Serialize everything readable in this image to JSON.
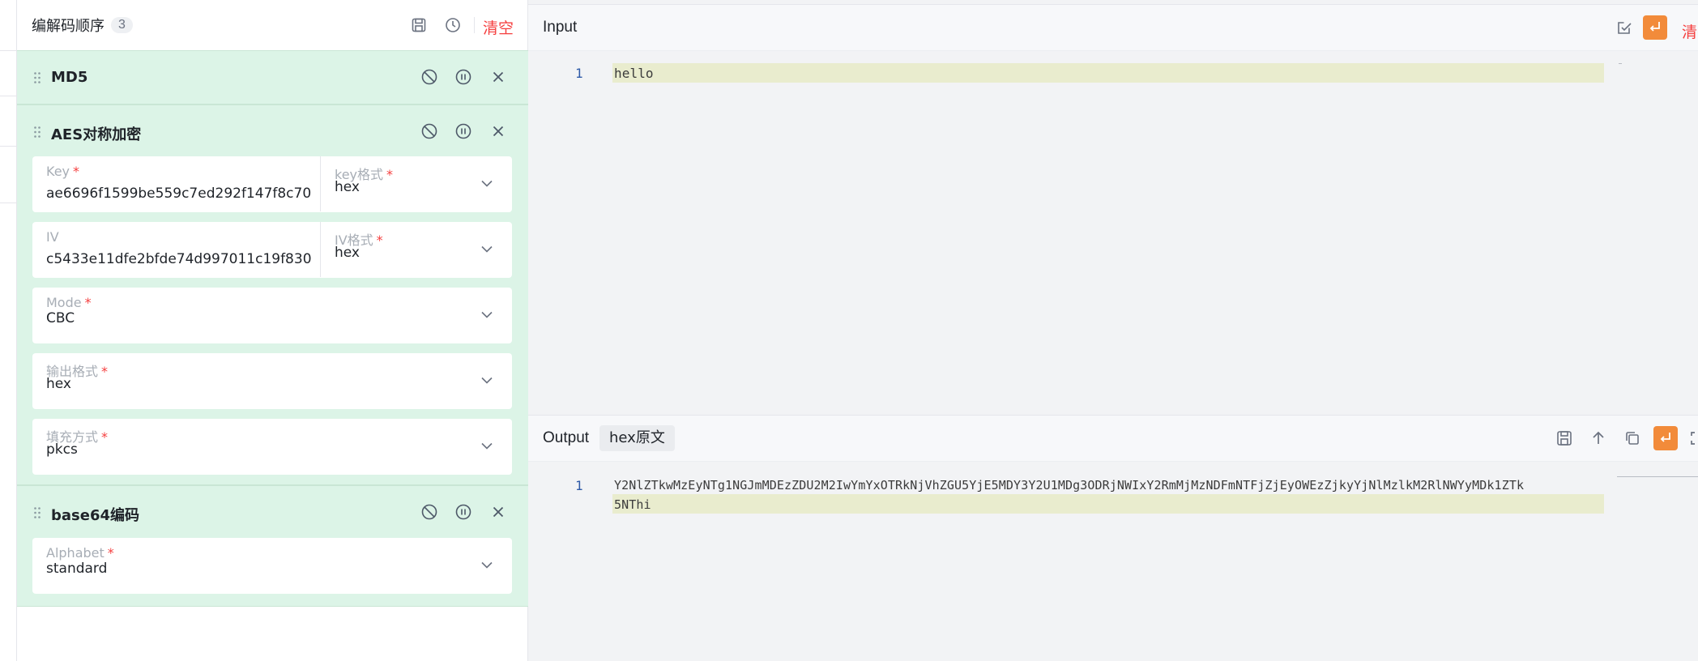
{
  "chain": {
    "title": "编解码顺序",
    "count": "3",
    "clear_label": "清空",
    "operations": [
      {
        "name": "MD5"
      },
      {
        "name": "AES对称加密",
        "fields": {
          "key_label": "Key",
          "key_value": "ae6696f1599be559c7ed292f147f8c70",
          "key_format_label": "key格式",
          "key_format_value": "hex",
          "iv_label": "IV",
          "iv_value": "c5433e11dfe2bfde74d997011c19f830",
          "iv_format_label": "IV格式",
          "iv_format_value": "hex",
          "mode_label": "Mode",
          "mode_value": "CBC",
          "output_format_label": "输出格式",
          "output_format_value": "hex",
          "padding_label": "填充方式",
          "padding_value": "pkcs"
        }
      },
      {
        "name": "base64编码",
        "fields": {
          "alphabet_label": "Alphabet",
          "alphabet_value": "standard"
        }
      }
    ],
    "required_mark": "*"
  },
  "input": {
    "title": "Input",
    "clear_label": "清",
    "line_number": "1",
    "text": "hello"
  },
  "output": {
    "title": "Output",
    "tag": "hex原文",
    "line_number": "1",
    "text_line1": "Y2NlZTkwMzEyNTg1NGJmMDEzZDU2M2IwYmYxOTRkNjVhZGU5YjE5MDY3Y2U1MDg3ODRjNWIxY2RmMjMzNDFmNTFjZjEyOWEzZjkyYjNlMzlkM2RlNWYyMDk1ZTk",
    "text_line2": "5NThi"
  },
  "colors": {
    "accent": "#f28b3a",
    "danger": "#f53f3f",
    "card_bg": "#dcf4e7",
    "highlight": "#e9ecce"
  },
  "icons": {
    "save": "save-icon",
    "history": "clock-icon",
    "disable": "ban-icon",
    "pause": "pause-icon",
    "remove": "close-icon",
    "wrap": "wrap-icon",
    "upload": "upload-icon",
    "copy": "copy-icon",
    "fullscreen": "fullscreen-icon",
    "check": "check-edit-icon",
    "drag": "drag-handle-icon",
    "chevron": "chevron-down-icon"
  }
}
